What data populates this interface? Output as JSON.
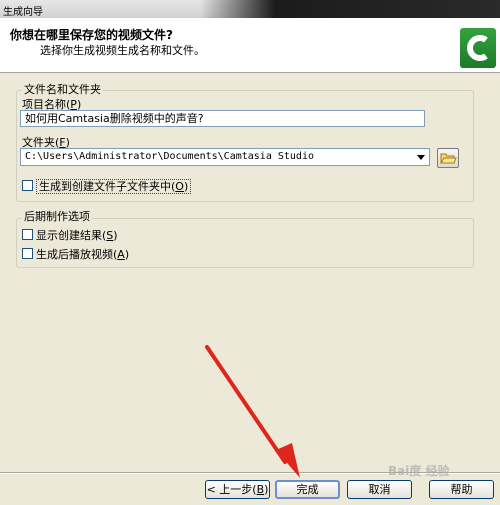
{
  "window": {
    "title": "生成向导"
  },
  "header": {
    "title": "你想在哪里保存您的视频文件?",
    "subtitle": "选择你生成视频生成名称和文件。"
  },
  "file_group": {
    "legend": "文件名和文件夹",
    "project_label": "项目名称(",
    "project_key": "P",
    "project_value": "如何用Camtasia删除视频中的声音?",
    "folder_label": "文件夹(",
    "folder_key": "F",
    "folder_value": "C:\\Users\\Administrator\\Documents\\Camtasia Studio",
    "subfolder_label": "生成到创建文件子文件夹中(",
    "subfolder_key": "O",
    "subfolder_checked": false
  },
  "post_group": {
    "legend": "后期制作选项",
    "show_results_label": "显示创建结果(",
    "show_results_key": "S",
    "show_results_checked": false,
    "play_after_label": "生成后播放视频(",
    "play_after_key": "A",
    "play_after_checked": false
  },
  "buttons": {
    "back": "< 上一步(",
    "back_key": "B",
    "finish": "完成",
    "cancel": "取消",
    "help": "帮助"
  },
  "watermark": "Bai度 经验",
  "colors": {
    "logo_green": "#2e8f35",
    "annotation_red": "#e0261c"
  }
}
